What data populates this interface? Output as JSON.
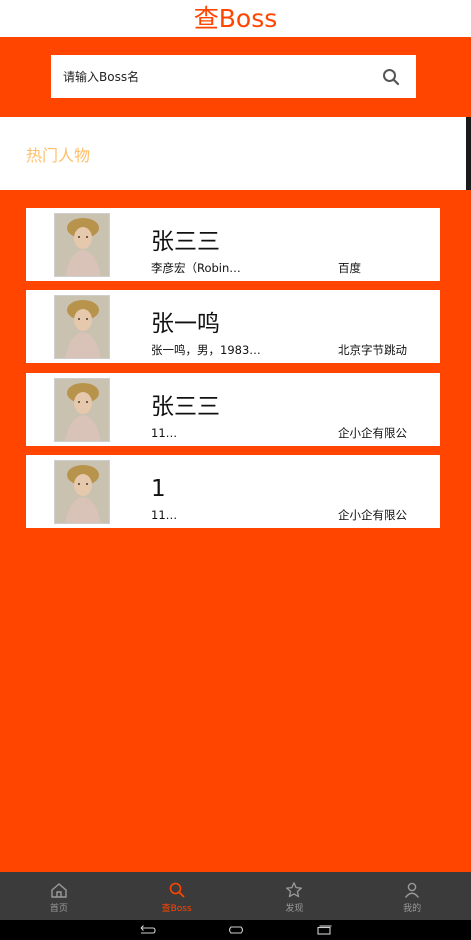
{
  "header": {
    "title": "查Boss"
  },
  "search": {
    "placeholder": "请输入Boss名"
  },
  "hot": {
    "label": "热门人物"
  },
  "people": [
    {
      "name": "张三三",
      "desc": "李彦宏（Robin…",
      "company": "百度"
    },
    {
      "name": "张一鸣",
      "desc": "张一鸣，男，1983…",
      "company": "北京字节跳动"
    },
    {
      "name": "张三三",
      "desc": "11…",
      "company": "企小企有限公"
    },
    {
      "name": "1",
      "desc": "11…",
      "company": "企小企有限公"
    }
  ],
  "tabs": [
    {
      "label": "首页",
      "icon": "home-icon",
      "active": false
    },
    {
      "label": "查Boss",
      "icon": "search-icon",
      "active": true
    },
    {
      "label": "发现",
      "icon": "star-icon",
      "active": false
    },
    {
      "label": "我的",
      "icon": "person-icon",
      "active": false
    }
  ],
  "colors": {
    "accent": "#ff4500",
    "hot_label": "#ffc06a",
    "tabbar": "#3b3b3b"
  }
}
